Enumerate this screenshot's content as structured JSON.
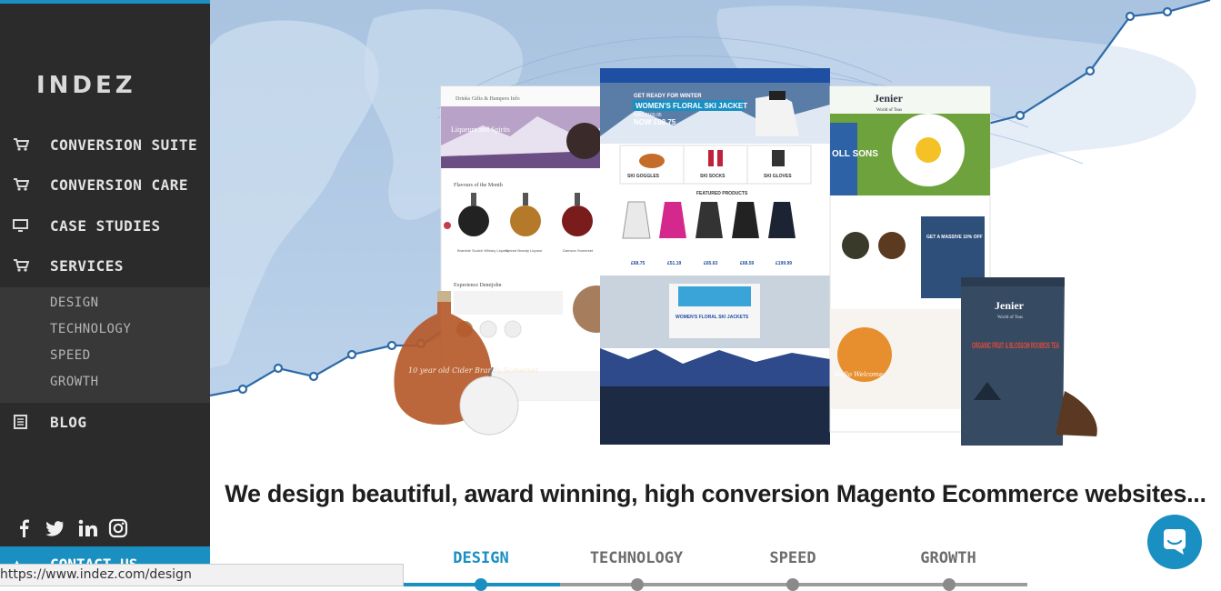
{
  "brand": {
    "logo_text": "INDEZ",
    "accent_color": "#1a8fc1",
    "sidebar_color": "#2b2b2b"
  },
  "nav": {
    "items": [
      {
        "label": "CONVERSION SUITE",
        "icon": "cart-icon"
      },
      {
        "label": "CONVERSION CARE",
        "icon": "cart-icon"
      },
      {
        "label": "CASE STUDIES",
        "icon": "monitor-icon"
      },
      {
        "label": "SERVICES",
        "icon": "cart-icon"
      },
      {
        "label": "BLOG",
        "icon": "document-icon"
      }
    ],
    "services_sub": [
      "DESIGN",
      "TECHNOLOGY",
      "SPEED",
      "GROWTH"
    ],
    "contact_label": "CONTACT US"
  },
  "social": [
    "facebook-icon",
    "twitter-icon",
    "linkedin-icon",
    "instagram-icon"
  ],
  "hero": {
    "left_site": {
      "heading": "Liqueurs and Spirits",
      "section": "Flavours of the Month",
      "products": [
        "Bramble Scotch Whisky Liqueur",
        "Spiced Brandy Liqueur",
        "Damson Somerset"
      ],
      "subheading": "Experience Demijohn",
      "bottle_text": "10 year old Cider Brandy Somerset"
    },
    "center_site": {
      "promo_small": "GET READY FOR WINTER",
      "promo_title": "WOMEN'S FLORAL SKI JACKET",
      "was_price": "WAS £169.95",
      "now_price": "NOW £68.75",
      "categories": [
        "SKI GOGGLES",
        "SKI SOCKS",
        "SKI GLOVES"
      ],
      "featured_heading": "FEATURED PRODUCTS",
      "prices": [
        "£68.75",
        "£51.19",
        "£65.63",
        "£68.59",
        "£199.99"
      ],
      "lower_banner": "WOMEN'S FLORAL SKI JACKETS"
    },
    "right_site": {
      "brand": "Jenier",
      "tagline": "World of Teas",
      "hero_text": "OLL SONS",
      "offer": "GET A MASSIVE 10% OFF",
      "welcome_text": "Hello Welcome",
      "pack_brand": "Jenier",
      "pack_sub": "World of Teas",
      "pack_title": "ORGANIC FRUIT & BLOSSOM ROOIBOS TEA"
    }
  },
  "headline": "We design beautiful, award winning, high conversion Magento Ecommerce websites...",
  "tabs": [
    {
      "label": "DESIGN",
      "active": true
    },
    {
      "label": "TECHNOLOGY",
      "active": false
    },
    {
      "label": "SPEED",
      "active": false
    },
    {
      "label": "GROWTH",
      "active": false
    }
  ],
  "status_bar_url": "https://www.indez.com/design",
  "chat_icon": "chat-icon"
}
